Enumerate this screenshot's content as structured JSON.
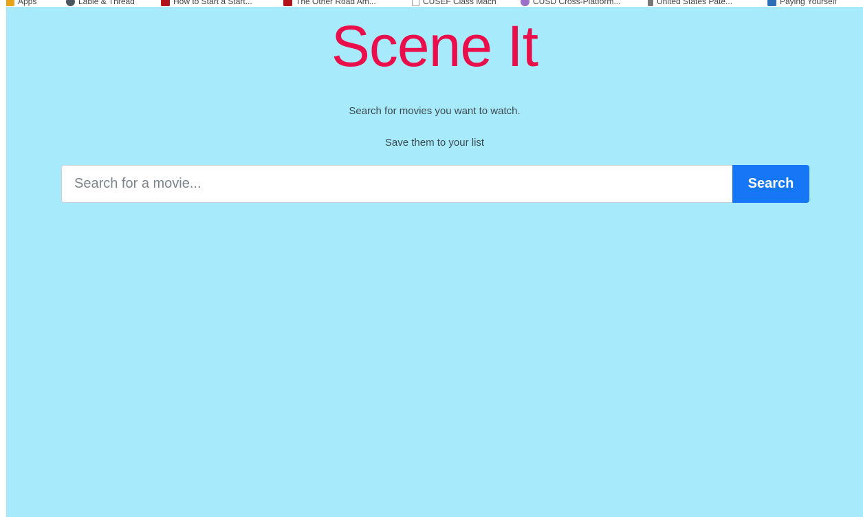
{
  "bookmarks_bar": {
    "items": [
      {
        "label": "Apps",
        "icon": "apps-grid-icon",
        "color": "#e8a317"
      },
      {
        "label": "Lable & Thread",
        "icon": "site-favicon-icon",
        "color": "#4a5560"
      },
      {
        "label": "How to Start a Start...",
        "icon": "site-favicon-icon",
        "color": "#b3121b"
      },
      {
        "label": "The Other Road Am...",
        "icon": "site-favicon-icon",
        "color": "#b3121b"
      },
      {
        "label": "CUSEF Class Mach",
        "icon": "page-icon",
        "color": "#ffffff"
      },
      {
        "label": "CUSD Cross-Platform...",
        "icon": "site-favicon-icon",
        "color": "#9c6fc9"
      },
      {
        "label": "United States Pate...",
        "icon": "site-favicon-icon",
        "color": "#777777"
      },
      {
        "label": "Paying Yourself",
        "icon": "site-favicon-icon",
        "color": "#2d6fb7"
      }
    ]
  },
  "header": {
    "title": "Scene It",
    "tagline_1": "Search for movies you want to watch.",
    "tagline_2": "Save them to your list"
  },
  "search": {
    "placeholder": "Search for a movie...",
    "value": "",
    "button_label": "Search"
  },
  "colors": {
    "background": "#a6eafc",
    "title": "#ea0e4a",
    "button": "#1577f6"
  }
}
